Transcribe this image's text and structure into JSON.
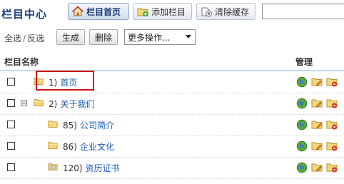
{
  "header": {
    "title": "栏目中心",
    "buttons": [
      {
        "label": "栏目首页",
        "icon": "home-icon"
      },
      {
        "label": "添加栏目",
        "icon": "add-folder-icon"
      },
      {
        "label": "清除缓存",
        "icon": "clear-cache-icon"
      }
    ],
    "search_value": ""
  },
  "actions": {
    "select_all": "全选",
    "separator": "/",
    "invert": "反选",
    "generate": "生成",
    "delete": "删除",
    "more_select": "更多操作..."
  },
  "table": {
    "col_name": "栏目名称",
    "col_manage": "管理",
    "rows": [
      {
        "num": "1)",
        "name": "首页",
        "level": 0,
        "expandable": false,
        "folder": "folder-icon"
      },
      {
        "num": "2)",
        "name": "关于我们",
        "level": 0,
        "expandable": true,
        "folder": "folder-icon"
      },
      {
        "num": "85)",
        "name": "公司简介",
        "level": 1,
        "expandable": false,
        "folder": "folder-icon"
      },
      {
        "num": "86)",
        "name": "企业文化",
        "level": 1,
        "expandable": false,
        "folder": "folder-icon"
      },
      {
        "num": "120)",
        "name": "资历证书",
        "level": 1,
        "expandable": false,
        "folder": "folder-list-icon"
      }
    ],
    "row_ops": [
      "preview-globe-icon",
      "edit-folder-icon",
      "delete-folder-icon"
    ]
  },
  "colors": {
    "title": "#1a3f7a",
    "link": "#1a5cb4",
    "highlight": "#d01515",
    "header_rule": "#c7d8ea"
  }
}
